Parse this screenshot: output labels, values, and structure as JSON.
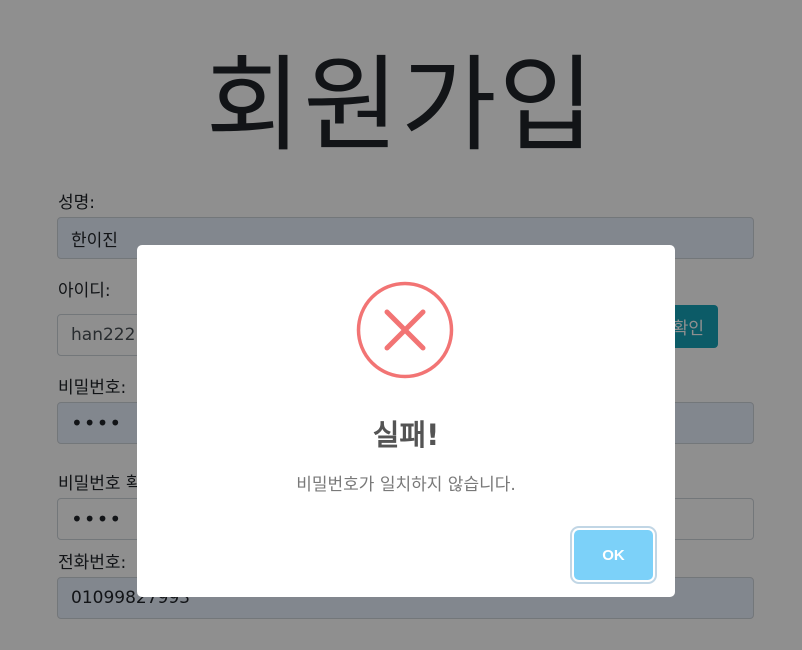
{
  "page": {
    "title": "회원가입"
  },
  "form": {
    "name": {
      "label": "성명:",
      "value": "한이진"
    },
    "user_id": {
      "label": "아이디:",
      "value": "han222",
      "check_button": "중복확인"
    },
    "password": {
      "label": "비밀번호:",
      "value": "••••"
    },
    "password_confirm": {
      "label": "비밀번호 확인:",
      "value": "••••"
    },
    "phone": {
      "label": "전화번호:",
      "value": "01099827993"
    }
  },
  "dialog": {
    "icon": "error-x-icon",
    "title": "실패!",
    "message": "비밀번호가 일치하지 않습니다.",
    "ok_label": "OK",
    "colors": {
      "error": "#f27474",
      "ok_button": "#7cd1f9",
      "overlay": "rgba(0,0,0,0.44)"
    }
  }
}
